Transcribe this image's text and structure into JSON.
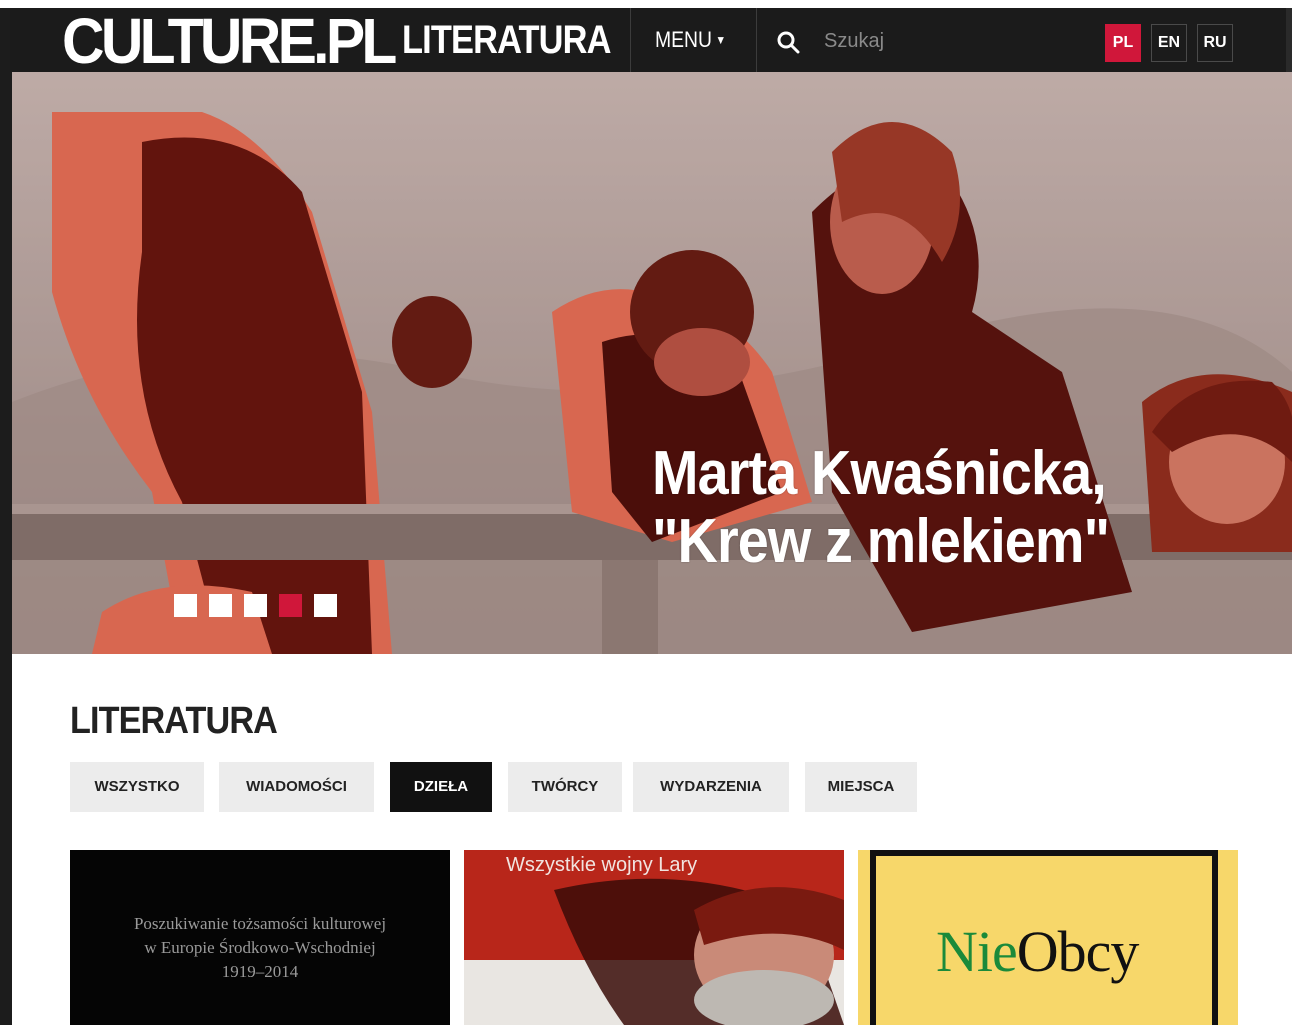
{
  "header": {
    "logo": "CULTURE.PL",
    "section": "LITERATURA",
    "menu_label": "MENU",
    "search_placeholder": "Szukaj",
    "languages": [
      {
        "code": "PL",
        "active": true
      },
      {
        "code": "EN",
        "active": false
      },
      {
        "code": "RU",
        "active": false
      }
    ]
  },
  "hero": {
    "caption_line1": "Marta Kwaśnicka,",
    "caption_line2": "\"Krew z mlekiem\"",
    "slide_count": 5,
    "active_slide": 4
  },
  "main": {
    "title": "LITERATURA",
    "filters": [
      {
        "label": "WSZYSTKO",
        "active": false
      },
      {
        "label": "WIADOMOŚCI",
        "active": false
      },
      {
        "label": "DZIEŁA",
        "active": true
      },
      {
        "label": "TWÓRCY",
        "active": false
      },
      {
        "label": "WYDARZENIA",
        "active": false
      },
      {
        "label": "MIEJSCA",
        "active": false
      }
    ],
    "cards": [
      {
        "lines": [
          "Poszukiwanie tożsamości kulturowej",
          "w Europie Środkowo-Wschodniej",
          "1919–2014"
        ]
      },
      {
        "title": "Wszystkie wojny Lary"
      },
      {
        "title_part1": "Nie",
        "title_part2": "Obcy"
      }
    ]
  },
  "colors": {
    "accent": "#d0173a",
    "header_bg": "#1b1b1b",
    "hero_tint": "#8a2418"
  }
}
